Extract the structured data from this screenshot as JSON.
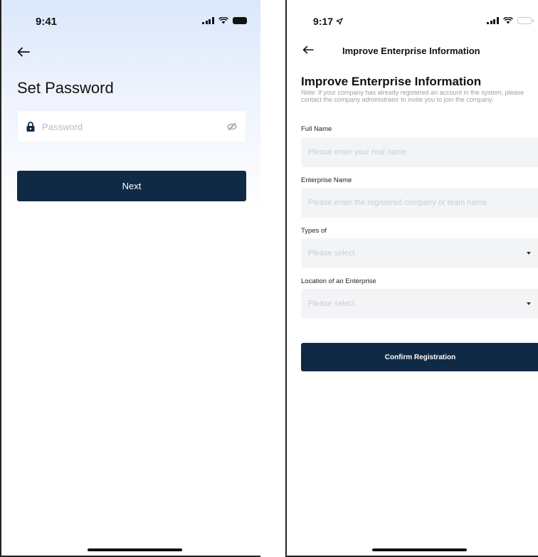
{
  "left_screen": {
    "status_time": "9:41",
    "title": "Set Password",
    "password": {
      "placeholder": "Password",
      "value": ""
    },
    "next_label": "Next",
    "icons": {
      "back": "arrow-left-icon",
      "lock": "lock-icon",
      "visibility": "eye-off-icon"
    }
  },
  "right_screen": {
    "status_time": "9:17",
    "nav_title": "Improve Enterprise Information",
    "title": "Improve Enterprise Information",
    "note": "Note: If your company has already registered an account in the system, please contact the company administrator to invite you to join the company.",
    "fields": {
      "full_name": {
        "label": "Full Name",
        "placeholder": "Please enter your real name",
        "value": ""
      },
      "enterprise_name": {
        "label": "Enterprise Name",
        "placeholder": "Please enter the registered company or team name",
        "value": ""
      },
      "types": {
        "label": "Types of",
        "selected": "Please select"
      },
      "location": {
        "label": "Location of an Enterprise",
        "selected": "Please select"
      }
    },
    "confirm_label": "Confirm Registration",
    "icons": {
      "back": "arrow-left-icon",
      "caret": "caret-down-icon",
      "location": "location-arrow-icon"
    }
  },
  "colors": {
    "primary_button": "#0f2a45",
    "gradient_top": "#dbe7fb",
    "input_bg": "#f3f4f6",
    "placeholder": "#c9ced5"
  }
}
